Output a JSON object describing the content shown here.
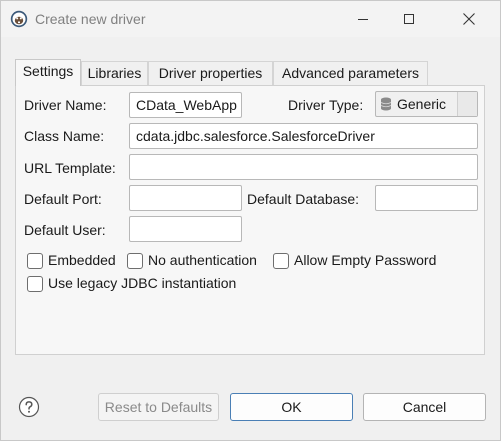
{
  "window": {
    "title": "Create new driver"
  },
  "tabs": [
    {
      "label": "Settings",
      "active": true
    },
    {
      "label": "Libraries",
      "active": false
    },
    {
      "label": "Driver properties",
      "active": false
    },
    {
      "label": "Advanced parameters",
      "active": false
    }
  ],
  "settings": {
    "driver_name_label": "Driver Name:",
    "driver_name_value": "CData_WebApp",
    "driver_type_label": "Driver Type:",
    "driver_type_value": "Generic",
    "class_name_label": "Class Name:",
    "class_name_value": "cdata.jdbc.salesforce.SalesforceDriver",
    "url_template_label": "URL Template:",
    "url_template_value": "",
    "default_port_label": "Default Port:",
    "default_port_value": "",
    "default_database_label": "Default Database:",
    "default_database_value": "",
    "default_user_label": "Default User:",
    "default_user_value": "",
    "checkboxes": [
      {
        "label": "Embedded",
        "checked": false
      },
      {
        "label": "No authentication",
        "checked": false
      },
      {
        "label": "Allow Empty Password",
        "checked": false
      },
      {
        "label": "Use legacy JDBC instantiation",
        "checked": false
      }
    ]
  },
  "footer": {
    "reset_label": "Reset to Defaults",
    "ok_label": "OK",
    "cancel_label": "Cancel"
  },
  "colors": {
    "focus_border": "#4a7fb5",
    "background": "#f0f0f0"
  }
}
